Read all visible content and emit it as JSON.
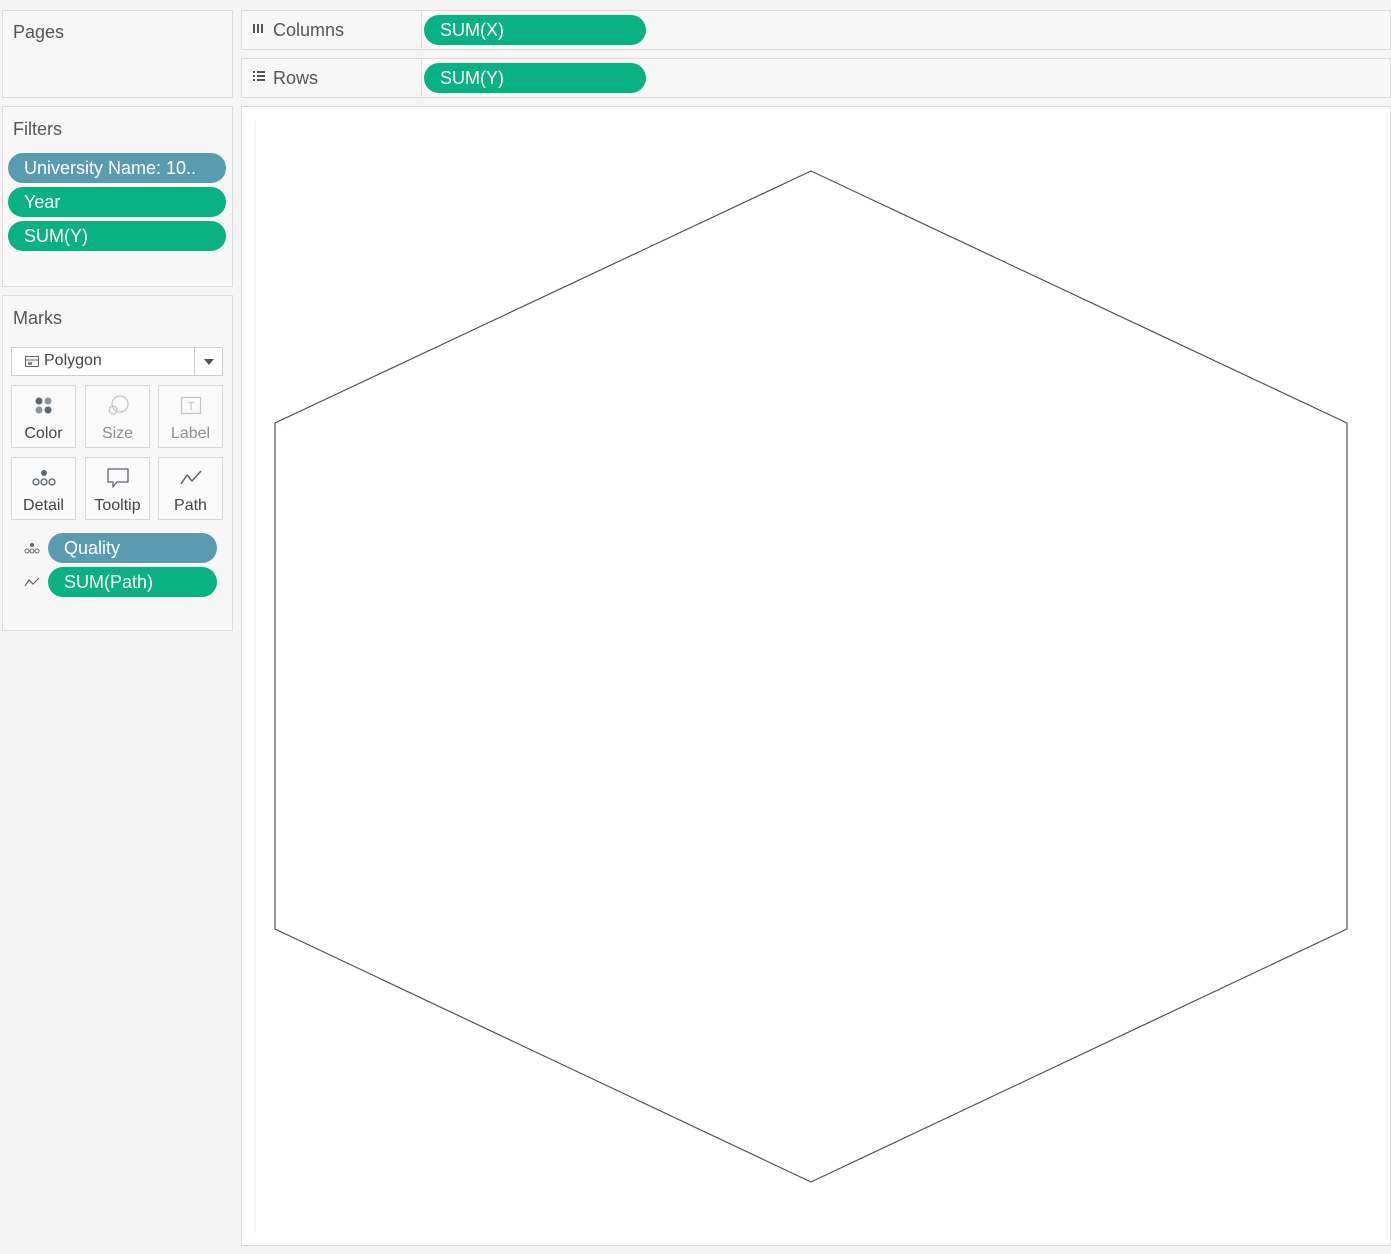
{
  "pages": {
    "title": "Pages"
  },
  "shelves": {
    "columns": {
      "label": "Columns",
      "icon": "columns-icon",
      "pill": "SUM(X)"
    },
    "rows": {
      "label": "Rows",
      "icon": "rows-icon",
      "pill": "SUM(Y)"
    }
  },
  "filters": {
    "title": "Filters",
    "items": [
      {
        "label": "University Name: 10..",
        "color": "#5b9bb0"
      },
      {
        "label": "Year",
        "color": "#0ab183"
      },
      {
        "label": "SUM(Y)",
        "color": "#0ab183"
      }
    ]
  },
  "marks": {
    "title": "Marks",
    "mark_type": "Polygon",
    "cards": [
      {
        "label": "Color",
        "icon": "color-icon",
        "enabled": true
      },
      {
        "label": "Size",
        "icon": "size-icon",
        "enabled": false
      },
      {
        "label": "Label",
        "icon": "label-icon",
        "enabled": false
      },
      {
        "label": "Detail",
        "icon": "detail-icon",
        "enabled": true
      },
      {
        "label": "Tooltip",
        "icon": "tooltip-icon",
        "enabled": true
      },
      {
        "label": "Path",
        "icon": "path-icon",
        "enabled": true
      }
    ],
    "fields": [
      {
        "label": "Quality",
        "icon": "detail-icon",
        "color": "#5b9bb0"
      },
      {
        "label": "SUM(Path)",
        "icon": "path-icon",
        "color": "#0ab183"
      }
    ]
  },
  "colors": {
    "measure_pill": "#0ab183",
    "dimension_pill": "#5b9bb0",
    "polygon_stroke": "#4a5560"
  }
}
